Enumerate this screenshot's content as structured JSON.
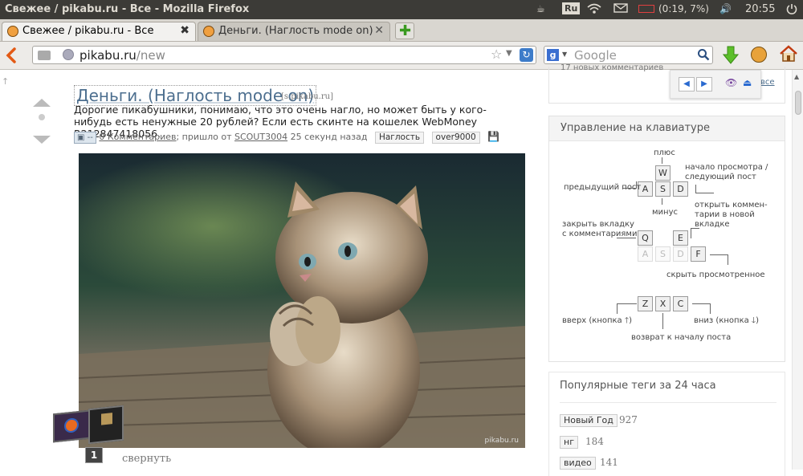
{
  "window": {
    "title": "Свежее / pikabu.ru - Все - Mozilla Firefox",
    "indicators": {
      "keyboard_layout": "Ru",
      "battery": "(0:19, 7%)",
      "clock": "20:55"
    }
  },
  "tabs": [
    {
      "label": "Свежее / pikabu.ru - Все",
      "active": true
    },
    {
      "label": "Деньги. (Наглость mode on)",
      "active": false
    }
  ],
  "nav": {
    "url_host": "pikabu.ru",
    "url_path": "/new",
    "search_placeholder": "Google"
  },
  "post": {
    "title": "Деньги. (Наглость mode on)",
    "source": "[s.pikabu.ru]",
    "body": "Дорогие пикабушники, понимаю, что это очень нагло, но может быть у кого-нибудь есть ненужные 20 рублей? Если есть скинте на кошелек WebMoney R212847418056.",
    "comments_link": "0 Комментариев",
    "sent_from": "; пришло от",
    "author": "SCOUT3004",
    "time_ago": "25 секунд назад",
    "tags": [
      "Наглость",
      "over9000"
    ],
    "watermark": "pikabu.ru",
    "comment_count_badge": "--"
  },
  "sidebar_top": {
    "partial_text": "17 новых комментариев",
    "partial_link": "все"
  },
  "keyboard_panel": {
    "title": "Управление на клавиатуре",
    "labels": {
      "plus": "плюс",
      "prev_post": "предыдущий пост",
      "next_post_line1": "начало просмотра /",
      "next_post_line2": "следующий пост",
      "minus": "минус",
      "close_tab_line1": "закрыть вкладку",
      "close_tab_line2": "с комментариями",
      "open_comments_line1": "открыть коммен-",
      "open_comments_line2": "тарии в новой",
      "open_comments_line3": "вкладке",
      "hide_viewed": "скрыть просмотренное",
      "up": "вверх (кнопка",
      "down": "вниз (кнопка",
      "back_to_start": "возврат к началу поста"
    },
    "keys": {
      "W": "W",
      "A": "A",
      "S": "S",
      "D": "D",
      "Q": "Q",
      "E": "E",
      "F": "F",
      "Z": "Z",
      "X": "X",
      "C": "C"
    }
  },
  "popular_tags": {
    "title": "Популярные теги за 24 часа",
    "items": [
      {
        "tag": "Новый Год",
        "count": "927"
      },
      {
        "tag": "нг",
        "count": "184"
      },
      {
        "tag": "видео",
        "count": "141"
      }
    ]
  },
  "taskbar_thumb": {
    "count": "1",
    "collapse_label": "свернуть"
  },
  "colors": {
    "accent_link": "#4d6f8f",
    "sysbar": "#3c3b37",
    "firefox_orange": "#e35a15"
  }
}
